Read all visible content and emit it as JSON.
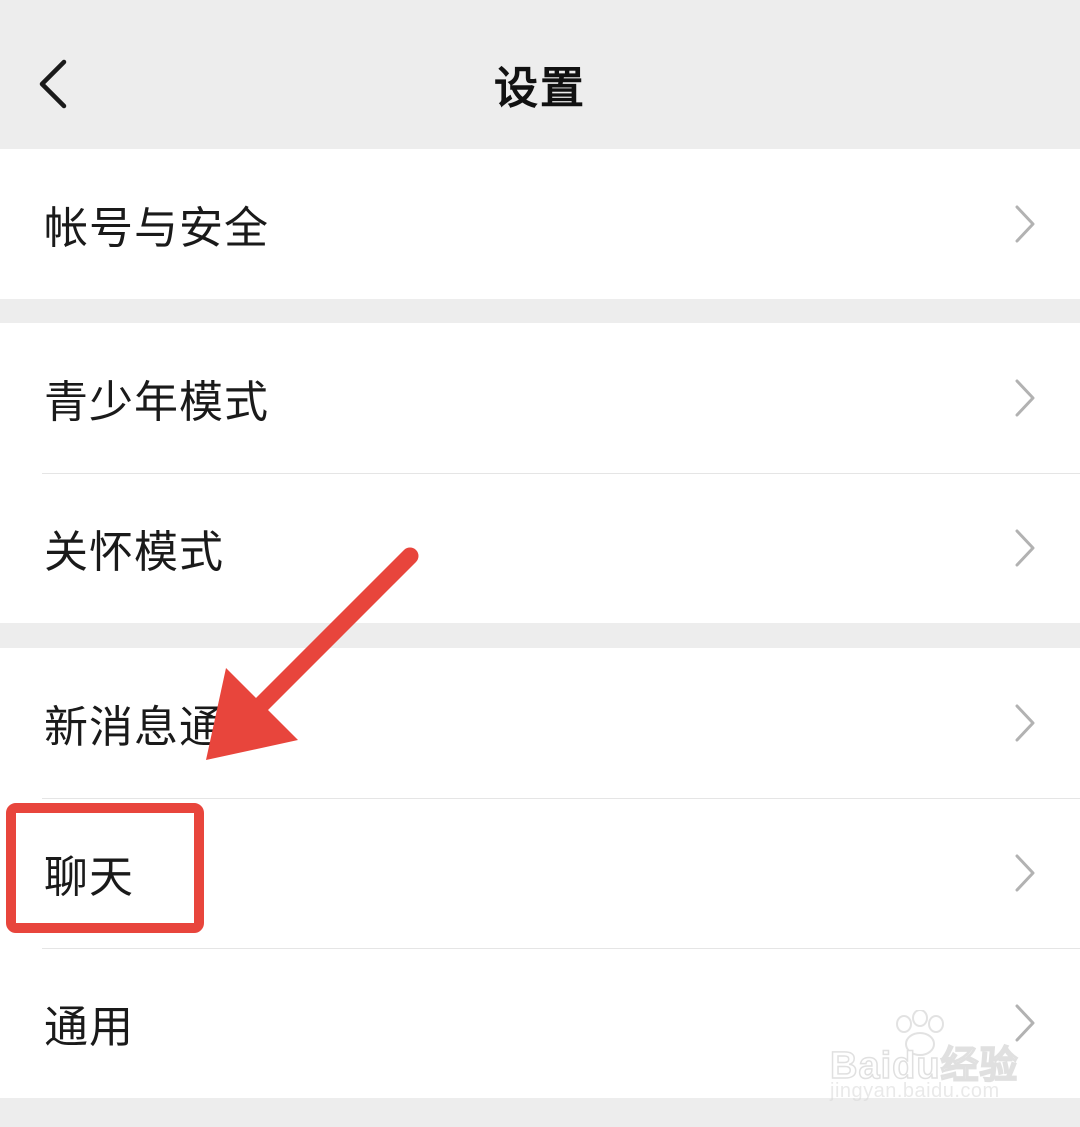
{
  "header": {
    "title": "设置",
    "back_icon": "chevron-left-icon"
  },
  "groups": [
    {
      "items": [
        {
          "label": "帐号与安全"
        }
      ]
    },
    {
      "items": [
        {
          "label": "青少年模式"
        },
        {
          "label": "关怀模式"
        }
      ]
    },
    {
      "items": [
        {
          "label": "新消息通知"
        },
        {
          "label": "聊天"
        },
        {
          "label": "通用"
        }
      ]
    }
  ],
  "annotation": {
    "highlighted_item": "聊天",
    "color": "#e8453c"
  },
  "watermark": {
    "brand": "Baidu经验",
    "url": "jingyan.baidu.com"
  }
}
